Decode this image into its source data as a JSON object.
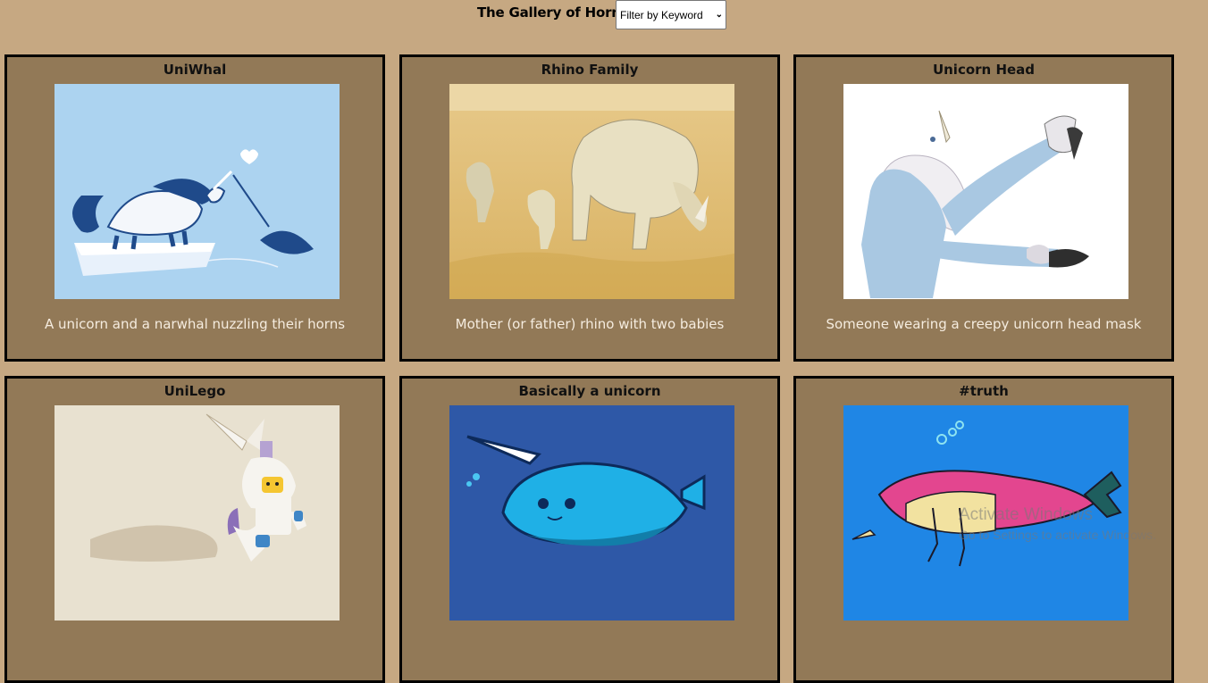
{
  "header": {
    "title": "The Gallery of Horns",
    "filter": {
      "selected": "Filter by Keyword"
    }
  },
  "cards": [
    {
      "title": "UniWhal",
      "description": "A unicorn and a narwhal nuzzling their horns",
      "image": "unicorn-narwhal-illustration"
    },
    {
      "title": "Rhino Family",
      "description": "Mother (or father) rhino with two babies",
      "image": "rhino-family-photo"
    },
    {
      "title": "Unicorn Head",
      "description": "Someone wearing a creepy unicorn head mask",
      "image": "unicorn-mask-photo"
    },
    {
      "title": "UniLego",
      "description": "",
      "image": "unicorn-lego-photo"
    },
    {
      "title": "Basically a unicorn",
      "description": "",
      "image": "narwhal-cartoon"
    },
    {
      "title": "#truth",
      "description": "",
      "image": "narwhal-unicorn-cartoon"
    }
  ],
  "watermark": {
    "line1": "Activate Windows",
    "line2": "Go to Settings to activate Windows."
  }
}
